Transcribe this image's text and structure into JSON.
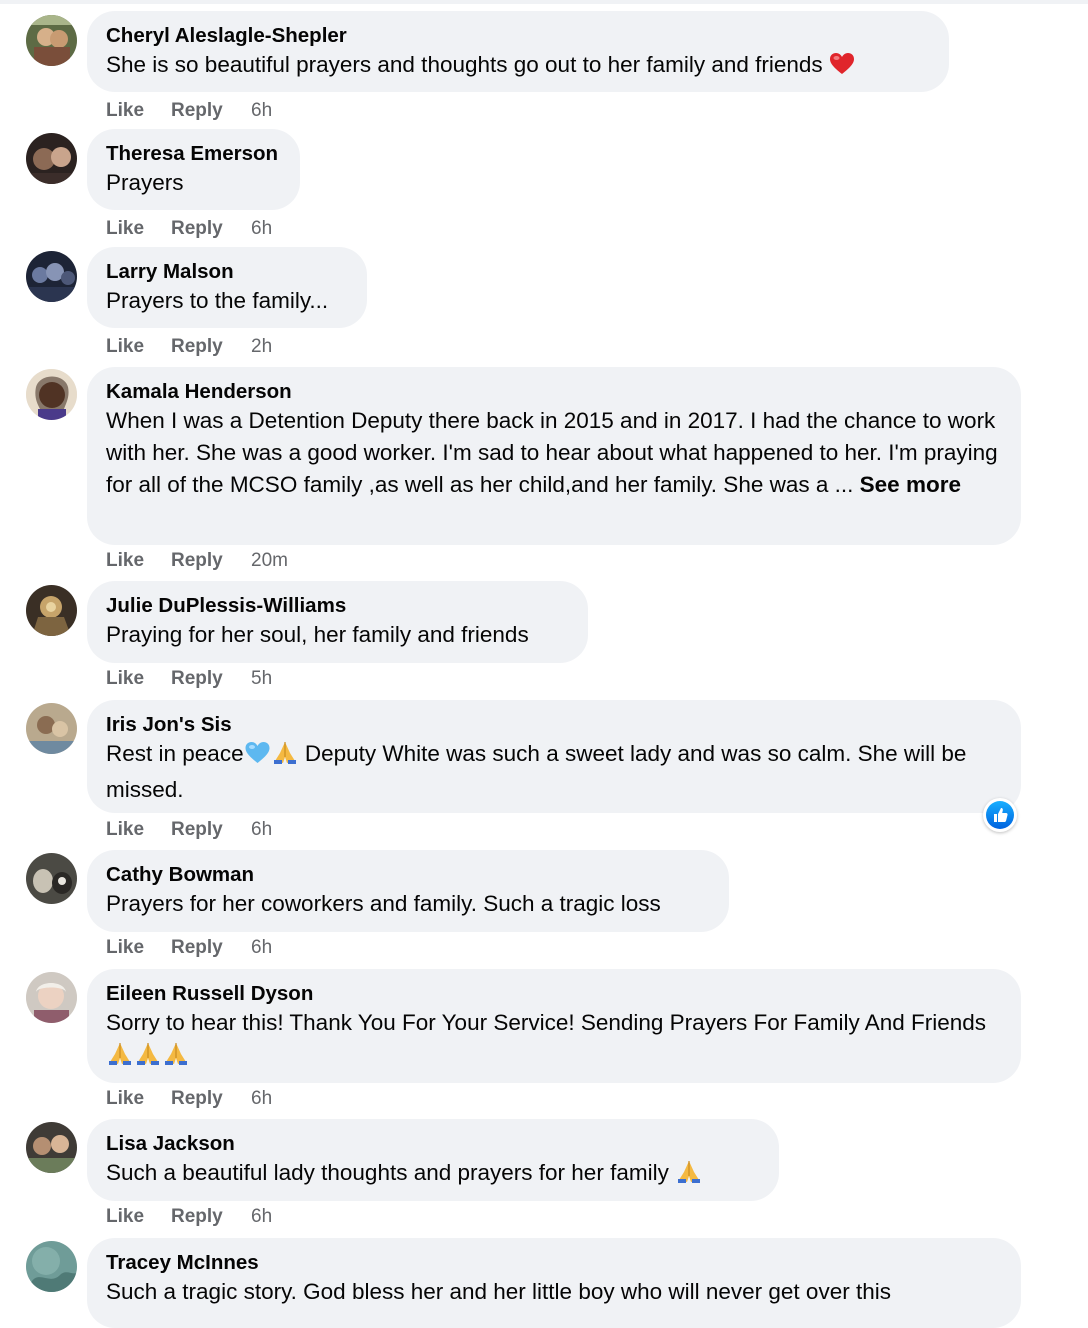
{
  "actions": {
    "like": "Like",
    "reply": "Reply"
  },
  "comments": [
    {
      "author": "Cheryl Aleslagle-Shepler",
      "text": "She is so beautiful prayers and thoughts go out to her family and friends",
      "time": "6h",
      "emoji": "red-heart"
    },
    {
      "author": "Theresa Emerson",
      "text": "Prayers",
      "time": "6h"
    },
    {
      "author": "Larry Malson",
      "text": "Prayers to the family...",
      "time": "2h"
    },
    {
      "author": "Kamala Henderson",
      "text": "When I was a Detention Deputy there back in 2015 and in 2017. I had the chance to work with her. She was a good worker. I'm sad to hear about what happened to her. I'm praying for all of the MCSO family ,as well as her child,and her family. She was a ...",
      "see_more": "See more",
      "time": "20m"
    },
    {
      "author": "Julie DuPlessis-Williams",
      "text": "Praying for her soul, her family and friends",
      "time": "5h"
    },
    {
      "author": "Iris Jon's Sis",
      "text_before": "Rest in peace",
      "text_after": " Deputy White was such a sweet lady and was so calm. She will be missed.",
      "time": "6h",
      "emoji": [
        "blue-heart",
        "folded-hands"
      ],
      "reaction": "like-reaction-icon"
    },
    {
      "author": "Cathy Bowman",
      "text": "Prayers for her coworkers and family. Such a tragic loss",
      "time": "6h"
    },
    {
      "author": "Eileen Russell Dyson",
      "text": "Sorry to hear this! Thank You For Your Service! Sending Prayers For Family And Friends",
      "time": "6h",
      "emoji": [
        "folded-hands",
        "folded-hands",
        "folded-hands"
      ]
    },
    {
      "author": "Lisa Jackson",
      "text": "Such a beautiful lady thoughts and prayers for her family",
      "time": "6h",
      "emoji": "folded-hands"
    },
    {
      "author": "Tracey McInnes",
      "text": "Such a tragic story. God bless her and her little boy who will never get over this"
    }
  ]
}
